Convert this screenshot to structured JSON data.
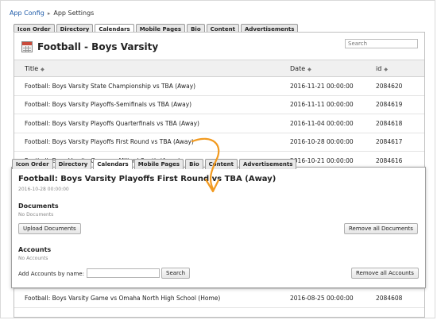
{
  "breadcrumb": {
    "items": [
      "App Config",
      "App Settings"
    ]
  },
  "tabs": [
    "Icon Order",
    "Directory",
    "Calendars",
    "Mobile Pages",
    "Bio",
    "Content",
    "Advertisements"
  ],
  "active_tab": "Calendars",
  "background_panel": {
    "title": "Football - Boys Varsity",
    "search_placeholder": "Search",
    "columns": {
      "title": "Title",
      "date": "Date",
      "id": "id",
      "sort_glyph": "◆"
    },
    "rows": [
      {
        "title": "Football: Boys Varsity State Championship vs TBA (Away)",
        "date": "2016-11-21 00:00:00",
        "id": "2084620"
      },
      {
        "title": "Football: Boys Varsity Playoffs-Semifinals vs TBA (Away)",
        "date": "2016-11-11 00:00:00",
        "id": "2084619"
      },
      {
        "title": "Football: Boys Varsity Playoffs Quarterfinals vs TBA (Away)",
        "date": "2016-11-04 00:00:00",
        "id": "2084618"
      },
      {
        "title": "Football: Boys Varsity Playoffs First Round vs TBA (Away)",
        "date": "2016-10-28 00:00:00",
        "id": "2084617"
      },
      {
        "title": "Football: Boys Varsity Game vs Millard South (Away)",
        "date": "2016-10-21 00:00:00",
        "id": "2084616"
      }
    ],
    "bottom_row": {
      "title": "Football: Boys Varsity Game vs Omaha North High School (Home)",
      "date": "2016-08-25 00:00:00",
      "id": "2084608"
    }
  },
  "popup": {
    "title": "Football: Boys Varsity Playoffs First Round vs TBA (Away)",
    "date": "2016-10-28 00:00:00",
    "documents": {
      "heading": "Documents",
      "empty": "No Documents",
      "upload_label": "Upload Documents",
      "remove_label": "Remove all Documents"
    },
    "accounts": {
      "heading": "Accounts",
      "empty": "No Accounts",
      "add_label": "Add Accounts by name:",
      "input_value": "",
      "search_label": "Search",
      "remove_label": "Remove all Accounts"
    }
  },
  "colors": {
    "link": "#1d5aa8",
    "arrow": "#f29a1f",
    "calendar_icon": "#c94a3a"
  },
  "icons": {
    "breadcrumb_separator": "chevron-right-icon",
    "calendar": "calendar-icon",
    "annotation": "curved-arrow"
  }
}
